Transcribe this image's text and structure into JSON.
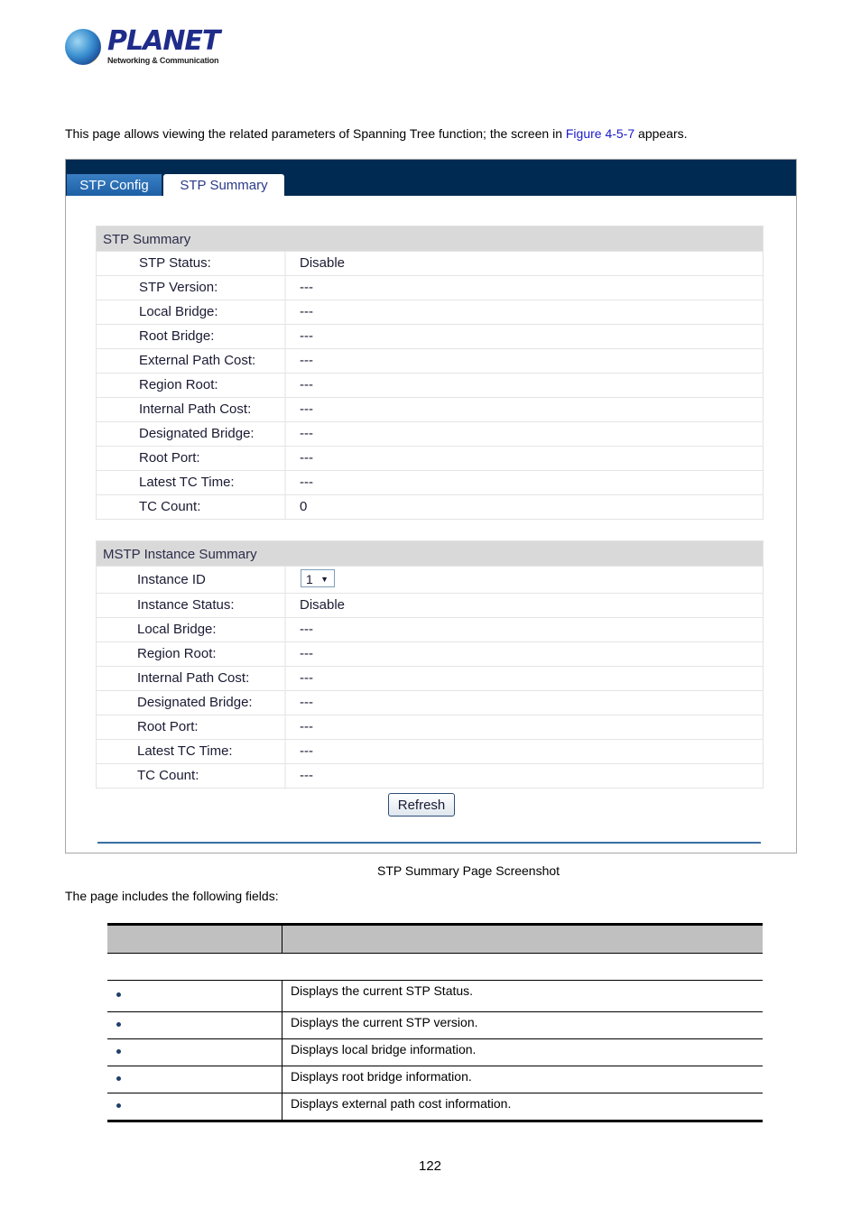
{
  "logo": {
    "brand": "PLANET",
    "tagline": "Networking & Communication"
  },
  "intro": {
    "before": "This page allows viewing the related parameters of Spanning Tree function; the screen in ",
    "link": "Figure 4-5-7",
    "after": " appears."
  },
  "screenshot": {
    "tabs": [
      {
        "label": "STP Config",
        "active": false
      },
      {
        "label": "STP Summary",
        "active": true
      }
    ],
    "stp_summary": {
      "title": "STP Summary",
      "rows": [
        {
          "label": "STP Status:",
          "value": "Disable"
        },
        {
          "label": "STP Version:",
          "value": "---"
        },
        {
          "label": "Local Bridge:",
          "value": "---"
        },
        {
          "label": "Root Bridge:",
          "value": "---"
        },
        {
          "label": "External Path Cost:",
          "value": "---"
        },
        {
          "label": "Region Root:",
          "value": "---"
        },
        {
          "label": "Internal Path Cost:",
          "value": "---"
        },
        {
          "label": "Designated Bridge:",
          "value": "---"
        },
        {
          "label": "Root Port:",
          "value": "---"
        },
        {
          "label": "Latest TC Time:",
          "value": "---"
        },
        {
          "label": "TC Count:",
          "value": "0"
        }
      ]
    },
    "mstp_summary": {
      "title": "MSTP Instance Summary",
      "instance_id_label": "Instance ID",
      "instance_id_value": "1",
      "rows": [
        {
          "label": "Instance Status:",
          "value": "Disable"
        },
        {
          "label": "Local Bridge:",
          "value": "---"
        },
        {
          "label": "Region Root:",
          "value": "---"
        },
        {
          "label": "Internal Path Cost:",
          "value": "---"
        },
        {
          "label": "Designated Bridge:",
          "value": "---"
        },
        {
          "label": "Root Port:",
          "value": "---"
        },
        {
          "label": "Latest TC Time:",
          "value": "---"
        },
        {
          "label": "TC Count:",
          "value": "---"
        }
      ]
    },
    "refresh_label": "Refresh"
  },
  "caption": "STP Summary Page Screenshot",
  "fields_intro": "The page includes the following fields:",
  "fields_table": {
    "rows": [
      {
        "description": "Displays the current STP Status."
      },
      {
        "description": "Displays the current STP version."
      },
      {
        "description": "Displays local bridge information."
      },
      {
        "description": "Displays root bridge information."
      },
      {
        "description": "Displays external path cost information."
      }
    ]
  },
  "page_number": "122"
}
